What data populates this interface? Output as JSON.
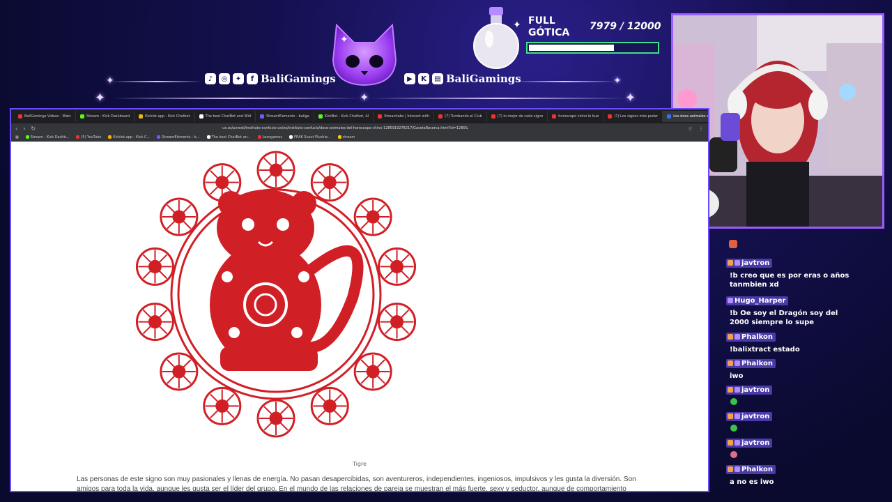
{
  "overlay": {
    "channel_left": "BaliGamings",
    "channel_right": "BaliGamings",
    "left_icons": [
      "tiktok-icon",
      "instagram-icon",
      "twitter-icon",
      "facebook-icon"
    ],
    "right_icons": [
      "youtube-icon",
      "kick-icon",
      "twitch-icon"
    ],
    "goal_title_1": "FULL",
    "goal_title_2": "GÓTICA",
    "goal_count": "7979  / 12000",
    "goal_progress": 0.665,
    "accent": "#9b5cff",
    "goal_color": "#3ee08a"
  },
  "browser": {
    "tabs": [
      {
        "label": "BaliGamings Videos - Watc",
        "color": "#e33"
      },
      {
        "label": "Stream - Kick Dashboard",
        "color": "#53fc18"
      },
      {
        "label": "Kicklet.app - Kick Chatbot",
        "color": "#f5b400"
      },
      {
        "label": "The best ChatBot and Wid",
        "color": "#fff"
      },
      {
        "label": "StreamElements - baliga",
        "color": "#6a5cff"
      },
      {
        "label": "KickBot - Kick Chatbot, Al",
        "color": "#53fc18"
      },
      {
        "label": "Streamlabs | Interact with",
        "color": "#e33"
      },
      {
        "label": "(7) Tumbando el Club",
        "color": "#e33"
      },
      {
        "label": "(7) lo mejor de cada signo",
        "color": "#e33"
      },
      {
        "label": "horoscopo chino lo bue",
        "color": "#e33"
      },
      {
        "label": "(7) Los signos más poder",
        "color": "#e33"
      },
      {
        "label": "Los doce animales del",
        "color": "#3a6cff",
        "active": true
      }
    ],
    "url": "ux.es/uvresti/instituto-confucio-uv/es/instituto-confucio/doce-animales-del-horoscopo-chino-1285919278217/GasetaRecerca.html?id=1280&",
    "bookmarks": [
      {
        "label": "Stream - Kick Dashb...",
        "color": "#53fc18"
      },
      {
        "label": "(5) YouTube",
        "color": "#e33"
      },
      {
        "label": "Kicklet.app - Kick C...",
        "color": "#f5b400"
      },
      {
        "label": "StreamElements - b...",
        "color": "#6a5cff"
      },
      {
        "label": "The best ChatBot an...",
        "color": "#fff"
      },
      {
        "label": "Lexogames",
        "color": "#e33"
      },
      {
        "label": "PEAK Scout Plushie...",
        "color": "#fff"
      },
      {
        "label": "stream",
        "color": "#f5d000"
      }
    ],
    "caption": "Tigre",
    "paragraph": "Las personas de este signo son muy pasionales y llenas de energía. No pasan desapercibidas, son aventureros, independientes, ingeniosos, impulsivos y les gusta la diversión. Son amigos para toda la vida, aunque les gusta ser el líder del grupo. En el mundo de las relaciones de pareja se muestran el más fuerte, sexy y seductor, aunque de comportamiento"
  },
  "chat": [
    {
      "user": "javtron",
      "text": "!b creo que es por eras o años tanmbien xd",
      "badge": "crown"
    },
    {
      "user": "Hugo_Harper",
      "text": "!b Oe soy el Dragón soy del 2000 siempre lo supe",
      "badge": "kick"
    },
    {
      "user": "Phalkon",
      "text": "!balixtract estado",
      "badge": "crown"
    },
    {
      "user": "Phalkon",
      "text": "iwo",
      "badge": "crown"
    },
    {
      "user": "javtron",
      "text": "",
      "emote": "#3ac24a",
      "badge": "crown"
    },
    {
      "user": "javtron",
      "text": "",
      "emote": "#3ac24a",
      "badge": "crown"
    },
    {
      "user": "javtron",
      "text": "",
      "emote": "#e0708a",
      "badge": "crown"
    },
    {
      "user": "Phalkon",
      "text": "a no es iwo",
      "badge": "crown"
    }
  ]
}
